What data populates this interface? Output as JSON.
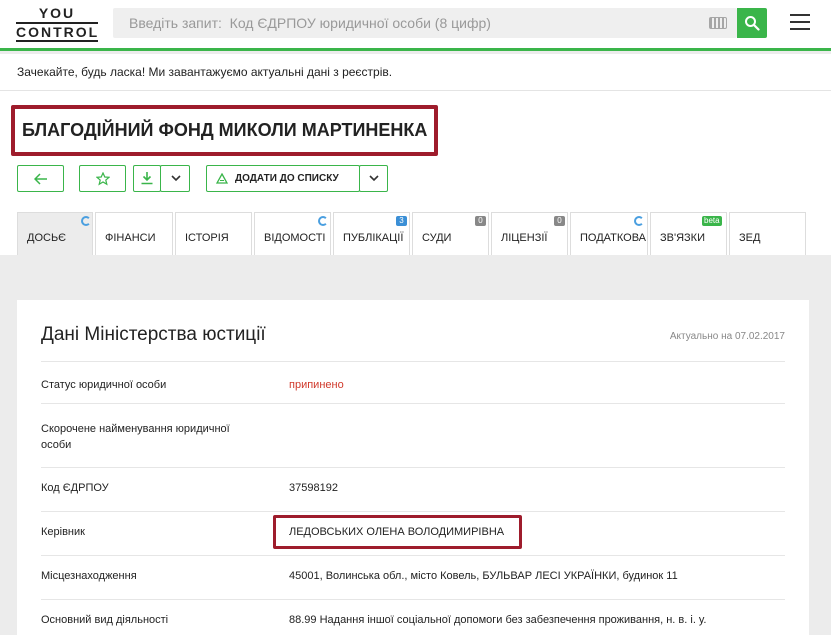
{
  "header": {
    "logo_top": "YOU",
    "logo_bottom": "CONTROL",
    "search_placeholder": "Введіть запит:  Код ЄДРПОУ юридичної особи (8 цифр)",
    "accent_color": "#3ab54a"
  },
  "notice": "Зачекайте, будь ласка! Ми завантажуємо актуальні дані з реєстрів.",
  "company": {
    "name": "БЛАГОДІЙНИЙ ФОНД МИКОЛИ МАРТИНЕНКА"
  },
  "actions": {
    "add_to_list": "ДОДАТИ ДО СПИСКУ"
  },
  "tabs": [
    {
      "label": "ДОСЬЄ",
      "active": true,
      "indicator": "sync"
    },
    {
      "label": "ФІНАНСИ"
    },
    {
      "label": "ІСТОРІЯ"
    },
    {
      "label": "ВІДОМОСТІ",
      "indicator": "sync"
    },
    {
      "label": "ПУБЛІКАЦІЇ",
      "badge": "3"
    },
    {
      "label": "СУДИ",
      "badge": "0"
    },
    {
      "label": "ЛІЦЕНЗІЇ",
      "badge": "0"
    },
    {
      "label": "ПОДАТКОВА",
      "indicator": "sync"
    },
    {
      "label": "ЗВ'ЯЗКИ",
      "badge": "beta"
    },
    {
      "label": "ЗЕД"
    }
  ],
  "card": {
    "title": "Дані Міністерства юстиції",
    "updated": "Актуально на 07.02.2017",
    "rows": [
      {
        "label": "Статус юридичної особи",
        "value": "припинено"
      },
      {
        "label": "Скорочене найменування юридичної особи",
        "value": ""
      },
      {
        "label": "Код ЄДРПОУ",
        "value": "37598192"
      },
      {
        "label": "Керівник",
        "value": "ЛЕДОВСЬКИХ ОЛЕНА ВОЛОДИМИРІВНА"
      },
      {
        "label": "Місцезнаходження",
        "value": "45001, Волинська обл., місто Ковель, БУЛЬВАР ЛЕСІ УКРАЇНКИ, будинок 11"
      },
      {
        "label": "Основний вид діяльності",
        "value": "88.99 Надання іншої соціальної допомоги без забезпечення проживання, н. в. і. у."
      }
    ]
  }
}
